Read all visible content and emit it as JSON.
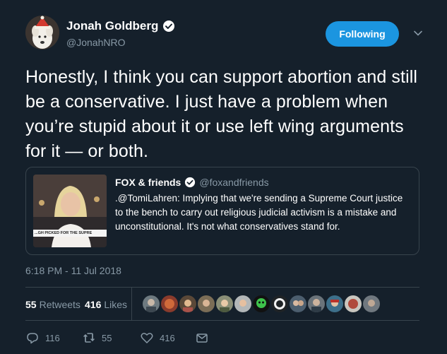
{
  "tweet": {
    "author": {
      "name": "Jonah Goldberg",
      "handle": "@JonahNRO",
      "follow_label": "Following"
    },
    "text": "Honestly, I think you can support abortion and still be a conservative. I just have a problem when you’re stupid about it or use left wing arguments for it — or both.",
    "quote": {
      "name": "FOX & friends",
      "handle": "@foxandfriends",
      "text": ".@TomiLahren: Implying that we're sending a Supreme Court justice to the bench to carry out religious judicial activism is a mistake and unconstitutional. It's not what conservatives stand for.",
      "ticker": "...GH PICKED FOR THE SUPRE"
    },
    "timestamp": "6:18 PM - 11 Jul 2018",
    "stats": {
      "retweets_count": "55",
      "retweets_label": "Retweets",
      "likes_count": "416",
      "likes_label": "Likes"
    },
    "actions": {
      "replies": "116",
      "retweets": "55",
      "likes": "416"
    },
    "icons": {
      "verified": "verified-badge-icon",
      "chevron": "chevron-down-icon",
      "reply": "reply-icon",
      "retweet": "retweet-icon",
      "like": "heart-icon",
      "message": "direct-message-icon"
    },
    "colors": {
      "background": "#15202b",
      "accent": "#1b95e0",
      "muted": "#8899a6",
      "border": "#38444d"
    }
  }
}
